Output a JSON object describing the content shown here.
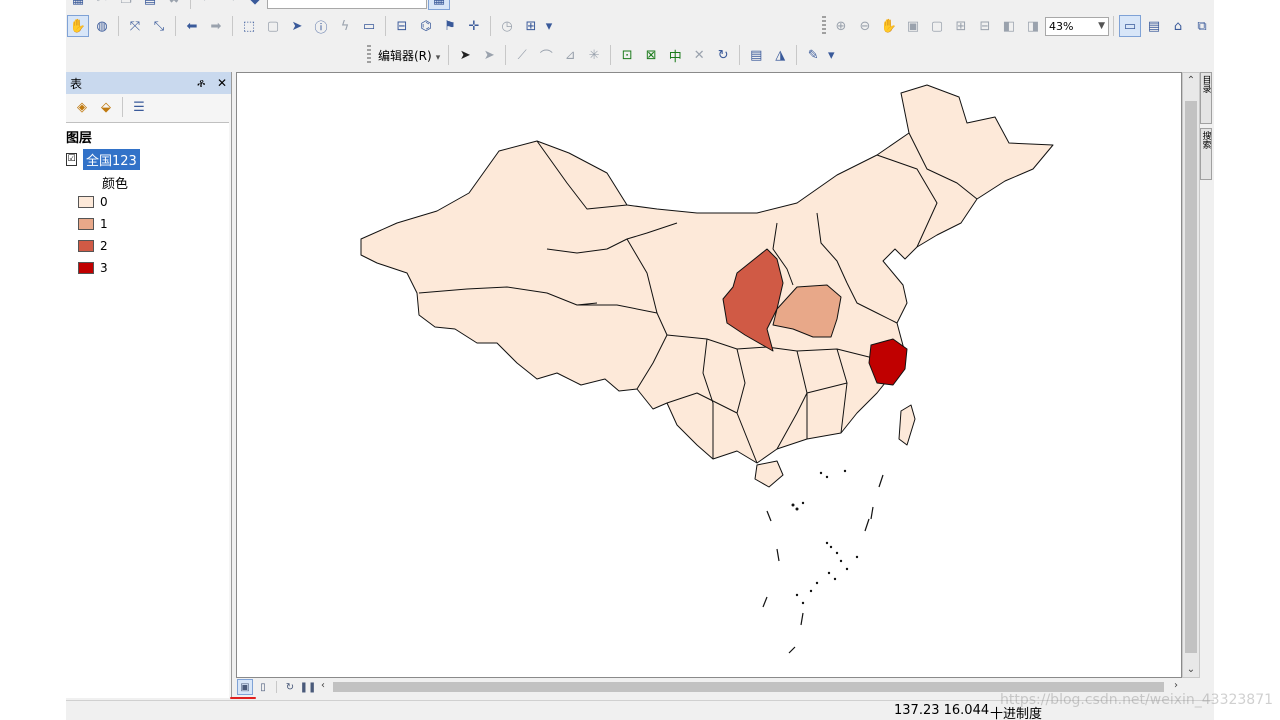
{
  "toolbar": {
    "scale_value": "43%",
    "editor_menu": "编辑器(R)"
  },
  "toc": {
    "title_fragment": "表",
    "pin_symbol": "ቶ",
    "close_symbol": "✕",
    "root_label": "图层",
    "layer_checked": "☑",
    "layer_name": "全国123",
    "field_name": "颜色",
    "legend": [
      {
        "label": "0",
        "color": "#fde9d9"
      },
      {
        "label": "1",
        "color": "#e8a889"
      },
      {
        "label": "2",
        "color": "#d05a45"
      },
      {
        "label": "3",
        "color": "#c00000"
      }
    ]
  },
  "map": {
    "default_fill": "#fde9d9",
    "highlight_shaanxi": "#d05a45",
    "highlight_henan": "#e8a889",
    "highlight_zhejiang": "#c00000"
  },
  "side_tabs": [
    "目录",
    "搜索"
  ],
  "status": {
    "coordinates": "137.23  16.044",
    "units": "十进制度"
  },
  "watermark": "https://blog.csdn.net/weixin_43323871"
}
